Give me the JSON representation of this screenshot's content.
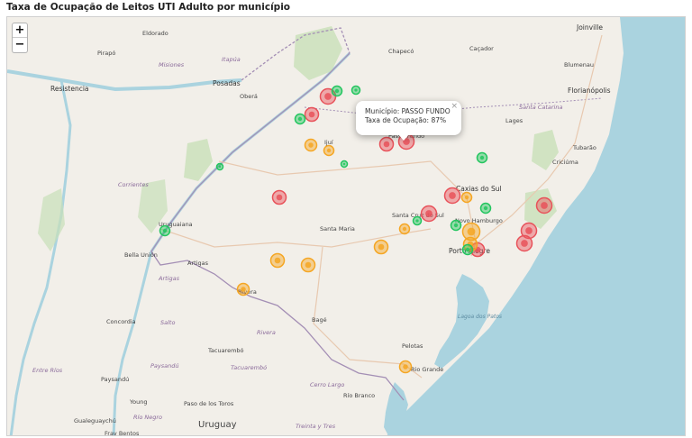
{
  "title": "Taxa de Ocupação de Leitos UTI Adulto por município",
  "zoom": {
    "in_label": "+",
    "out_label": "−"
  },
  "popup": {
    "line1": "Município: PASSO FUNDO",
    "line2": "Taxa de Ocupação: 87%",
    "close": "×"
  },
  "colors": {
    "water": "#aad3df",
    "land": "#f2efe9",
    "low": "#22c55e",
    "mid": "#f5a623",
    "high": "#e8525a",
    "border": "#a48fb5"
  },
  "place_labels": [
    {
      "text": "Joinville",
      "cls": "city"
    },
    {
      "text": "Blumenau",
      "cls": "small"
    },
    {
      "text": "Florianópolis",
      "cls": "city"
    },
    {
      "text": "Santa Catarina",
      "cls": "region"
    },
    {
      "text": "Lages",
      "cls": "small"
    },
    {
      "text": "Tubarão",
      "cls": "small"
    },
    {
      "text": "Criciúma",
      "cls": "small"
    },
    {
      "text": "Caçador",
      "cls": "small"
    },
    {
      "text": "Chapecó",
      "cls": "small"
    },
    {
      "text": "Posadas",
      "cls": "city"
    },
    {
      "text": "Resistencia",
      "cls": "city"
    },
    {
      "text": "Misiones",
      "cls": "region"
    },
    {
      "text": "Itapúa",
      "cls": "region"
    },
    {
      "text": "Corrientes",
      "cls": "region"
    },
    {
      "text": "Ijuí",
      "cls": "small"
    },
    {
      "text": "Passo Fundo",
      "cls": "small"
    },
    {
      "text": "Caxias do Sul",
      "cls": "city"
    },
    {
      "text": "Santa Cruz do Sul",
      "cls": "small"
    },
    {
      "text": "Novo Hamburgo",
      "cls": "small"
    },
    {
      "text": "Santa Maria",
      "cls": "small"
    },
    {
      "text": "Porto Alegre",
      "cls": "city"
    },
    {
      "text": "Uruguaiana",
      "cls": "small"
    },
    {
      "text": "Bella Unión",
      "cls": "small"
    },
    {
      "text": "Artigas",
      "cls": "small"
    },
    {
      "text": "Artigas",
      "cls": "region"
    },
    {
      "text": "Rivera",
      "cls": "small"
    },
    {
      "text": "Rivera",
      "cls": "region"
    },
    {
      "text": "Bagé",
      "cls": "small"
    },
    {
      "text": "Concordia",
      "cls": "small"
    },
    {
      "text": "Salto",
      "cls": "region"
    },
    {
      "text": "Tacuarembó",
      "cls": "small"
    },
    {
      "text": "Tacuarembó",
      "cls": "region"
    },
    {
      "text": "Paysandú",
      "cls": "region"
    },
    {
      "text": "Paysandú",
      "cls": "small"
    },
    {
      "text": "Entre Ríos",
      "cls": "region"
    },
    {
      "text": "Young",
      "cls": "small"
    },
    {
      "text": "Paso de los Toros",
      "cls": "small"
    },
    {
      "text": "Río Negro",
      "cls": "region"
    },
    {
      "text": "Uruguay",
      "cls": "country"
    },
    {
      "text": "Gualeguaychú",
      "cls": "small"
    },
    {
      "text": "Fray Bentos",
      "cls": "small"
    },
    {
      "text": "Cerro Largo",
      "cls": "region"
    },
    {
      "text": "Treinta y Tres",
      "cls": "region"
    },
    {
      "text": "Río Branco",
      "cls": "small"
    },
    {
      "text": "Pelotas",
      "cls": "small"
    },
    {
      "text": "Rio Grande",
      "cls": "small"
    },
    {
      "text": "Lagoa dos Patos",
      "cls": "water"
    },
    {
      "text": "Eldorado",
      "cls": "small"
    },
    {
      "text": "Pirapó",
      "cls": "small"
    },
    {
      "text": "Oberá",
      "cls": "small"
    }
  ],
  "markers": [
    {
      "city": "PASSO FUNDO",
      "rate": "high"
    },
    {
      "city": "",
      "rate": "high"
    },
    {
      "city": "",
      "rate": "high"
    },
    {
      "city": "",
      "rate": "high"
    },
    {
      "city": "",
      "rate": "high"
    },
    {
      "city": "",
      "rate": "high"
    },
    {
      "city": "",
      "rate": "high"
    },
    {
      "city": "",
      "rate": "high"
    },
    {
      "city": "",
      "rate": "high"
    },
    {
      "city": "",
      "rate": "high"
    },
    {
      "city": "",
      "rate": "high"
    },
    {
      "city": "",
      "rate": "mid"
    },
    {
      "city": "",
      "rate": "mid"
    },
    {
      "city": "",
      "rate": "mid"
    },
    {
      "city": "",
      "rate": "mid"
    },
    {
      "city": "",
      "rate": "mid"
    },
    {
      "city": "",
      "rate": "mid"
    },
    {
      "city": "",
      "rate": "mid"
    },
    {
      "city": "",
      "rate": "mid"
    },
    {
      "city": "",
      "rate": "mid"
    },
    {
      "city": "",
      "rate": "mid"
    },
    {
      "city": "",
      "rate": "mid"
    },
    {
      "city": "",
      "rate": "low"
    },
    {
      "city": "",
      "rate": "low"
    },
    {
      "city": "",
      "rate": "low"
    },
    {
      "city": "",
      "rate": "low"
    },
    {
      "city": "",
      "rate": "low"
    },
    {
      "city": "",
      "rate": "low"
    },
    {
      "city": "",
      "rate": "low"
    },
    {
      "city": "",
      "rate": "low"
    },
    {
      "city": "",
      "rate": "low"
    },
    {
      "city": "",
      "rate": "low"
    },
    {
      "city": "",
      "rate": "low"
    }
  ]
}
